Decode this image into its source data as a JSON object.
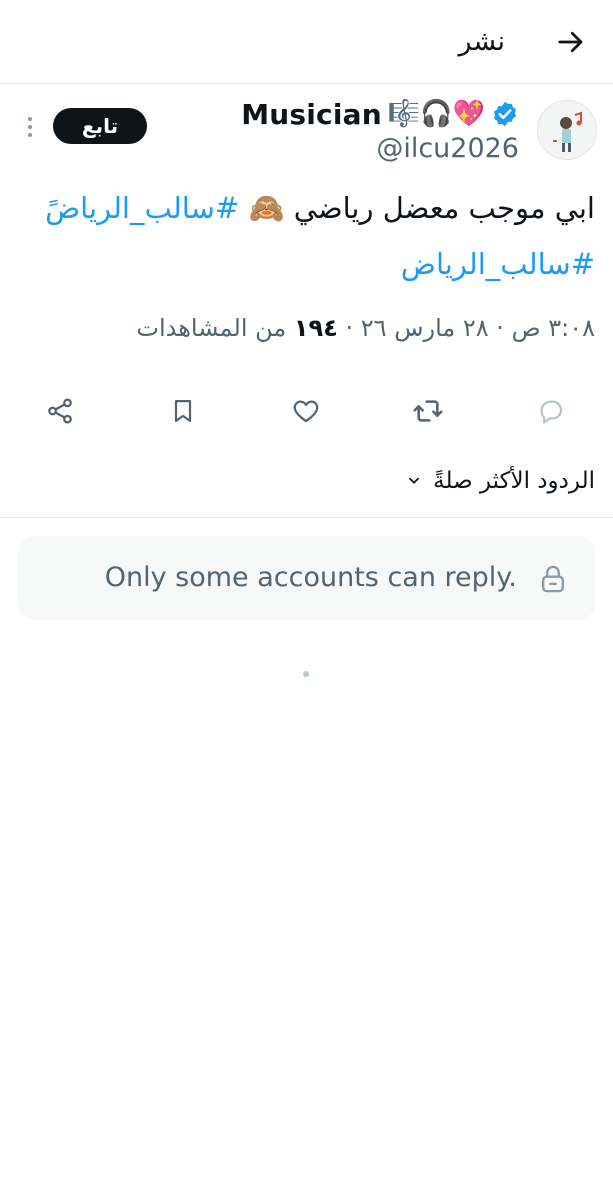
{
  "header": {
    "title": "نشر",
    "back_icon": "arrow-right-icon"
  },
  "author": {
    "display_name": "Musician",
    "name_emojis": "🎼🎧💖",
    "verified_icon": "verified-badge-icon",
    "handle": "@ilcu2026",
    "avatar_icon": "avatar-icon"
  },
  "follow_button": {
    "label": "تابع"
  },
  "more_icon": "more-vertical-icon",
  "tweet": {
    "text_before": "ابي موجب معضل رياضي 🙈 ",
    "hashtag_1": "#سالب_الرياضً",
    "hashtag_2": "#سالب_الرياض"
  },
  "meta": {
    "time": "٣:٠٨ ص",
    "date": "٢٨ مارس ٢٦",
    "views_count": "١٩٤",
    "views_label": "من المشاهدات",
    "separator": "·"
  },
  "actions": {
    "reply_icon": "reply-icon",
    "retweet_icon": "retweet-icon",
    "like_icon": "heart-icon",
    "bookmark_icon": "bookmark-icon",
    "share_icon": "share-icon"
  },
  "sort": {
    "label": "الردود الأكثر صلةً",
    "chevron_icon": "chevron-down-icon"
  },
  "reply_restriction": {
    "text": "Only some accounts can reply.",
    "icon": "lock-icon"
  },
  "colors": {
    "accent": "#1d9bf0",
    "text_primary": "#0f1419",
    "text_secondary": "#536471",
    "border": "#e6e9eb",
    "reply_box_bg": "#f7f9f9"
  }
}
